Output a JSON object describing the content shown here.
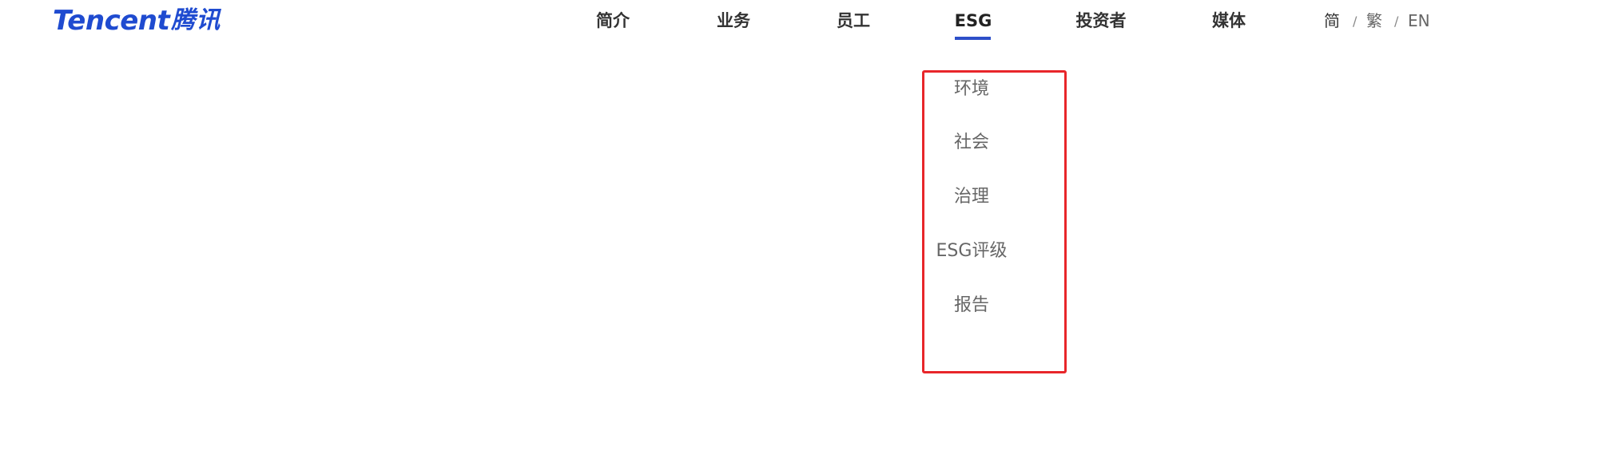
{
  "logo": {
    "latin": "Tencent",
    "cn": "腾讯",
    "color": "#1f4bd0"
  },
  "nav": {
    "items": [
      {
        "label": "简介"
      },
      {
        "label": "业务"
      },
      {
        "label": "员工"
      },
      {
        "label": "ESG"
      },
      {
        "label": "投资者"
      },
      {
        "label": "媒体"
      }
    ],
    "active": "ESG",
    "underline_color": "#2d4fc9"
  },
  "lang": {
    "simplified": "简",
    "traditional": "繁",
    "english": "EN",
    "separator": "/"
  },
  "dropdown": {
    "items": [
      {
        "label": "环境"
      },
      {
        "label": "社会"
      },
      {
        "label": "治理"
      },
      {
        "label": "ESG评级"
      },
      {
        "label": "报告"
      }
    ],
    "highlight_color": "#e8262a"
  }
}
